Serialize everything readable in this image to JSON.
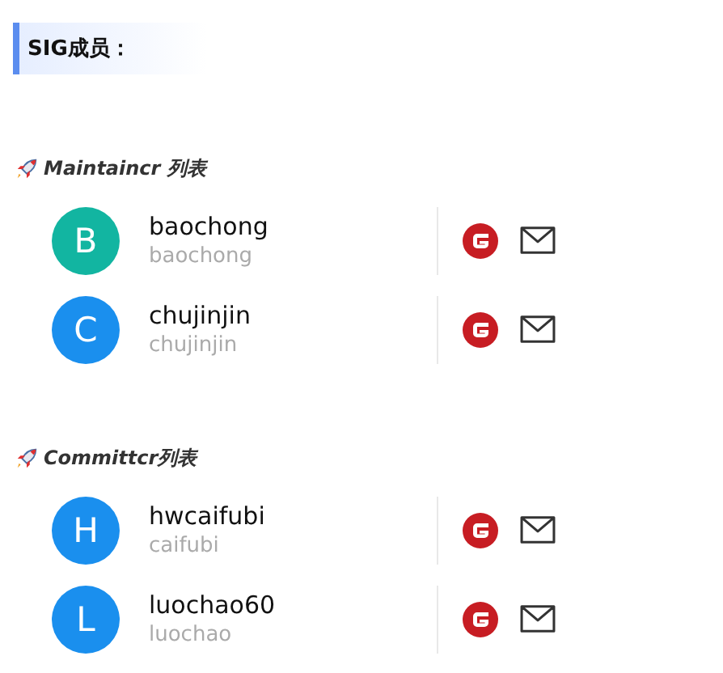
{
  "heading": "SIG成员：",
  "sections": [
    {
      "title": "Maintaincr 列表",
      "members": [
        {
          "initial": "B",
          "color": "#12b5a1",
          "name": "baochong",
          "username": "baochong"
        },
        {
          "initial": "C",
          "color": "#1a8fee",
          "name": "chujinjin",
          "username": "chujinjin"
        }
      ]
    },
    {
      "title": "Committcr列表",
      "members": [
        {
          "initial": "H",
          "color": "#1a8fee",
          "name": "hwcaifubi",
          "username": "caifubi"
        },
        {
          "initial": "L",
          "color": "#1a8fee",
          "name": "luochao60",
          "username": "luochao"
        }
      ]
    }
  ]
}
